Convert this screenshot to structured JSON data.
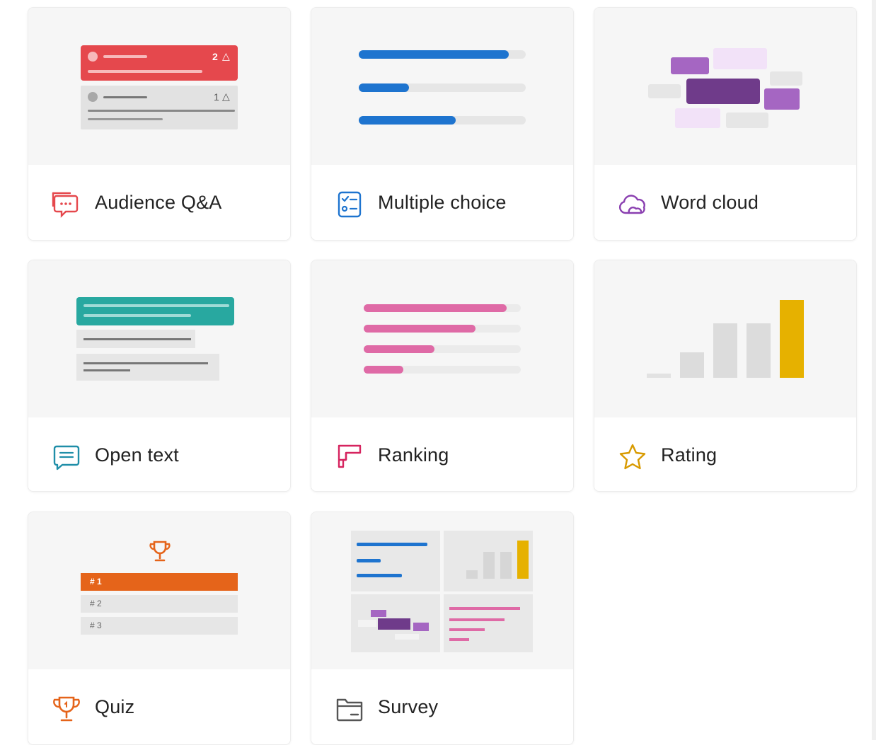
{
  "cards": [
    {
      "id": "audience-qa",
      "label": "Audience Q&A",
      "icon": "speech-bubbles-icon",
      "preview": {
        "top_count": "2",
        "bottom_count": "1"
      }
    },
    {
      "id": "multiple-choice",
      "label": "Multiple choice",
      "icon": "checklist-icon",
      "preview": {
        "bar_fractions": [
          0.9,
          0.3,
          0.58
        ]
      }
    },
    {
      "id": "word-cloud",
      "label": "Word cloud",
      "icon": "cloud-icon"
    },
    {
      "id": "open-text",
      "label": "Open text",
      "icon": "text-message-icon"
    },
    {
      "id": "ranking",
      "label": "Ranking",
      "icon": "ranking-bars-icon",
      "preview": {
        "bar_fractions": [
          0.91,
          0.71,
          0.45,
          0.25
        ]
      }
    },
    {
      "id": "rating",
      "label": "Rating",
      "icon": "star-icon",
      "preview": {
        "levels": [
          0.05,
          0.33,
          0.7,
          0.7,
          1.0
        ]
      }
    },
    {
      "id": "quiz",
      "label": "Quiz",
      "icon": "trophy-icon",
      "preview": {
        "ranks": [
          "# 1",
          "# 2",
          "# 3"
        ]
      }
    },
    {
      "id": "survey",
      "label": "Survey",
      "icon": "folder-form-icon"
    }
  ],
  "colors": {
    "qa_red": "#e5484d",
    "mc_blue": "#1e74cf",
    "wc_purple": "#6f3b8a",
    "wc_light": "#ecd9f3",
    "wc_mid": "#a566c2",
    "ot_teal": "#28a8a0",
    "rank_pink": "#df6aa6",
    "rating_yellow": "#e6b100",
    "quiz_orange": "#e5641a",
    "survey_gray": "#555555"
  }
}
